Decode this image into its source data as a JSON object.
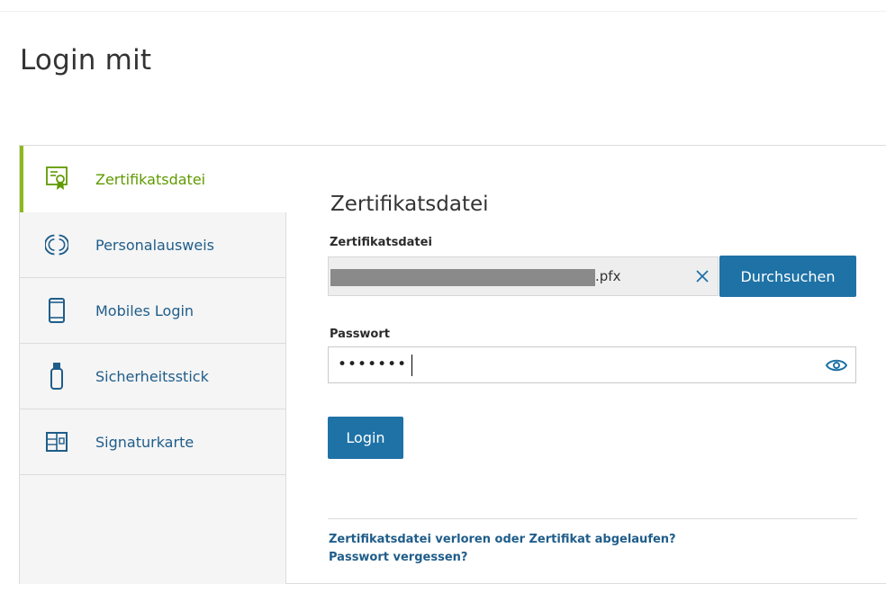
{
  "page": {
    "title": "Login mit"
  },
  "sidebar": {
    "items": [
      {
        "label": "Zertifikatsdatei",
        "icon": "certificate-icon",
        "active": true
      },
      {
        "label": "Personalausweis",
        "icon": "id-card-nfc-icon",
        "active": false
      },
      {
        "label": "Mobiles Login",
        "icon": "smartphone-icon",
        "active": false
      },
      {
        "label": "Sicherheitsstick",
        "icon": "usb-stick-icon",
        "active": false
      },
      {
        "label": "Signaturkarte",
        "icon": "signature-card-icon",
        "active": false
      }
    ]
  },
  "form": {
    "title": "Zertifikatsdatei",
    "file_label": "Zertifikatsdatei",
    "file_value_visible": ".pfx",
    "browse_label": "Durchsuchen",
    "password_label": "Passwort",
    "password_mask": "•••••••",
    "login_label": "Login"
  },
  "links": {
    "lost_certificate": "Zertifikatsdatei verloren oder Zertifikat abgelaufen?",
    "forgot_password": "Passwort vergessen?"
  },
  "colors": {
    "accent_green": "#8cb91e",
    "primary_blue": "#1e72a6",
    "link_blue": "#1f5d8a"
  }
}
